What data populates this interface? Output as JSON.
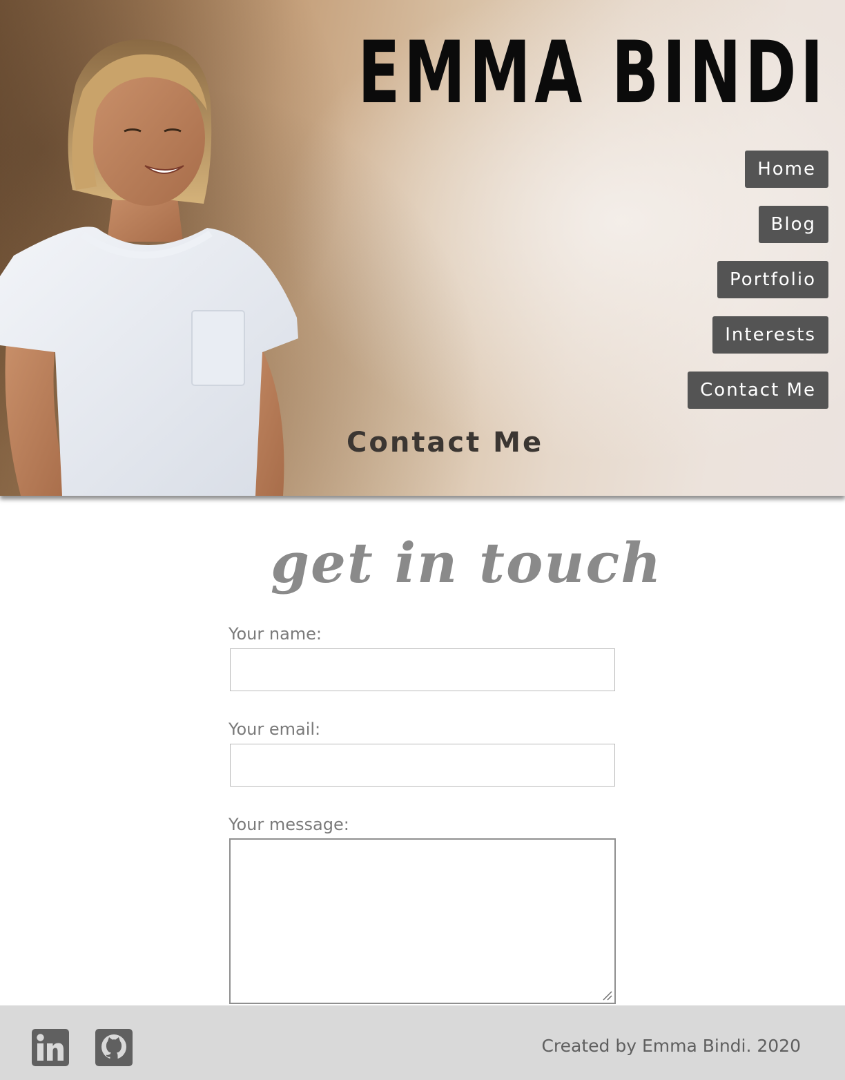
{
  "header": {
    "site_title": "EMMA BINDI",
    "page_heading": "Contact Me"
  },
  "nav": {
    "items": [
      {
        "label": "Home"
      },
      {
        "label": "Blog"
      },
      {
        "label": "Portfolio"
      },
      {
        "label": "Interests"
      },
      {
        "label": "Contact Me"
      }
    ]
  },
  "form": {
    "title": "get in touch",
    "name_label": "Your name:",
    "name_value": "",
    "email_label": "Your email:",
    "email_value": "",
    "message_label": "Your message:",
    "message_value": ""
  },
  "footer": {
    "social": [
      {
        "name": "linkedin-icon"
      },
      {
        "name": "github-icon"
      }
    ],
    "credit": "Created by Emma Bindi. 2020"
  },
  "colors": {
    "nav_button_bg": "#545454",
    "nav_button_text": "#ffffff",
    "title_text": "#0b0b0b",
    "form_title": "#8a8a8a",
    "label_text": "#7a7a7a",
    "footer_bg": "#d9d9d9",
    "footer_icon": "#5f5f5f"
  }
}
